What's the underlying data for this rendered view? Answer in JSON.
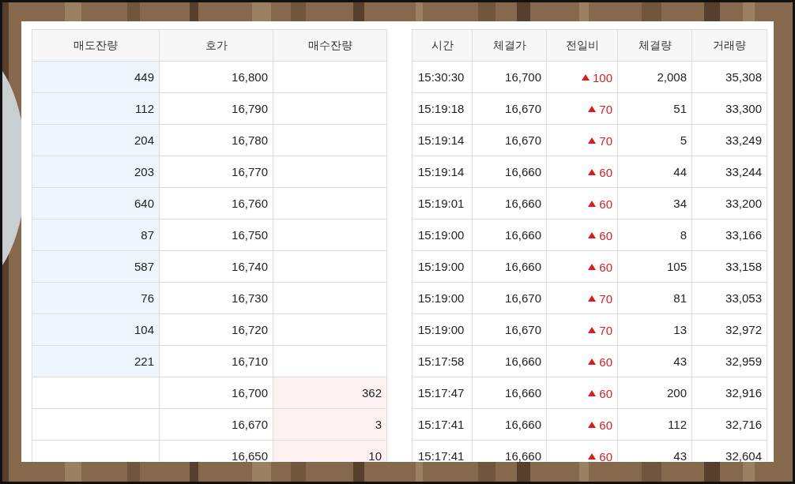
{
  "order_book": {
    "columns": [
      "매도잔량",
      "호가",
      "매수잔량"
    ],
    "rows": [
      {
        "kind": "ask",
        "ask_volume": "449",
        "price": "16,800"
      },
      {
        "kind": "ask",
        "ask_volume": "112",
        "price": "16,790"
      },
      {
        "kind": "ask",
        "ask_volume": "204",
        "price": "16,780"
      },
      {
        "kind": "ask",
        "ask_volume": "203",
        "price": "16,770"
      },
      {
        "kind": "ask",
        "ask_volume": "640",
        "price": "16,760"
      },
      {
        "kind": "ask",
        "ask_volume": "87",
        "price": "16,750"
      },
      {
        "kind": "ask",
        "ask_volume": "587",
        "price": "16,740"
      },
      {
        "kind": "ask",
        "ask_volume": "76",
        "price": "16,730"
      },
      {
        "kind": "ask",
        "ask_volume": "104",
        "price": "16,720"
      },
      {
        "kind": "ask",
        "ask_volume": "221",
        "price": "16,710"
      },
      {
        "kind": "bid",
        "price": "16,700",
        "bid_volume": "362"
      },
      {
        "kind": "bid",
        "price": "16,670",
        "bid_volume": "3"
      },
      {
        "kind": "bid",
        "price": "16,650",
        "bid_volume": "10"
      }
    ]
  },
  "trades": {
    "columns": [
      "시간",
      "체결가",
      "전일비",
      "체결량",
      "거래량"
    ],
    "rows": [
      {
        "time": "15:30:30",
        "price": "16,700",
        "kind": "up",
        "change": "100",
        "volume": "2,008",
        "cumulative": "35,308"
      },
      {
        "time": "15:19:18",
        "price": "16,670",
        "kind": "up",
        "change": "70",
        "volume": "51",
        "cumulative": "33,300"
      },
      {
        "time": "15:19:14",
        "price": "16,670",
        "kind": "up",
        "change": "70",
        "volume": "5",
        "cumulative": "33,249"
      },
      {
        "time": "15:19:14",
        "price": "16,660",
        "kind": "up",
        "change": "60",
        "volume": "44",
        "cumulative": "33,244"
      },
      {
        "time": "15:19:01",
        "price": "16,660",
        "kind": "up",
        "change": "60",
        "volume": "34",
        "cumulative": "33,200"
      },
      {
        "time": "15:19:00",
        "price": "16,660",
        "kind": "up",
        "change": "60",
        "volume": "8",
        "cumulative": "33,166"
      },
      {
        "time": "15:19:00",
        "price": "16,660",
        "kind": "up",
        "change": "60",
        "volume": "105",
        "cumulative": "33,158"
      },
      {
        "time": "15:19:00",
        "price": "16,670",
        "kind": "up",
        "change": "70",
        "volume": "81",
        "cumulative": "33,053"
      },
      {
        "time": "15:19:00",
        "price": "16,670",
        "kind": "up",
        "change": "70",
        "volume": "13",
        "cumulative": "32,972"
      },
      {
        "time": "15:17:58",
        "price": "16,660",
        "kind": "up",
        "change": "60",
        "volume": "43",
        "cumulative": "32,959"
      },
      {
        "time": "15:17:47",
        "price": "16,660",
        "kind": "up",
        "change": "60",
        "volume": "200",
        "cumulative": "32,916"
      },
      {
        "time": "15:17:41",
        "price": "16,660",
        "kind": "up",
        "change": "60",
        "volume": "112",
        "cumulative": "32,716"
      },
      {
        "time": "15:17:41",
        "price": "16,660",
        "kind": "up",
        "change": "60",
        "volume": "43",
        "cumulative": "32,604"
      }
    ]
  }
}
